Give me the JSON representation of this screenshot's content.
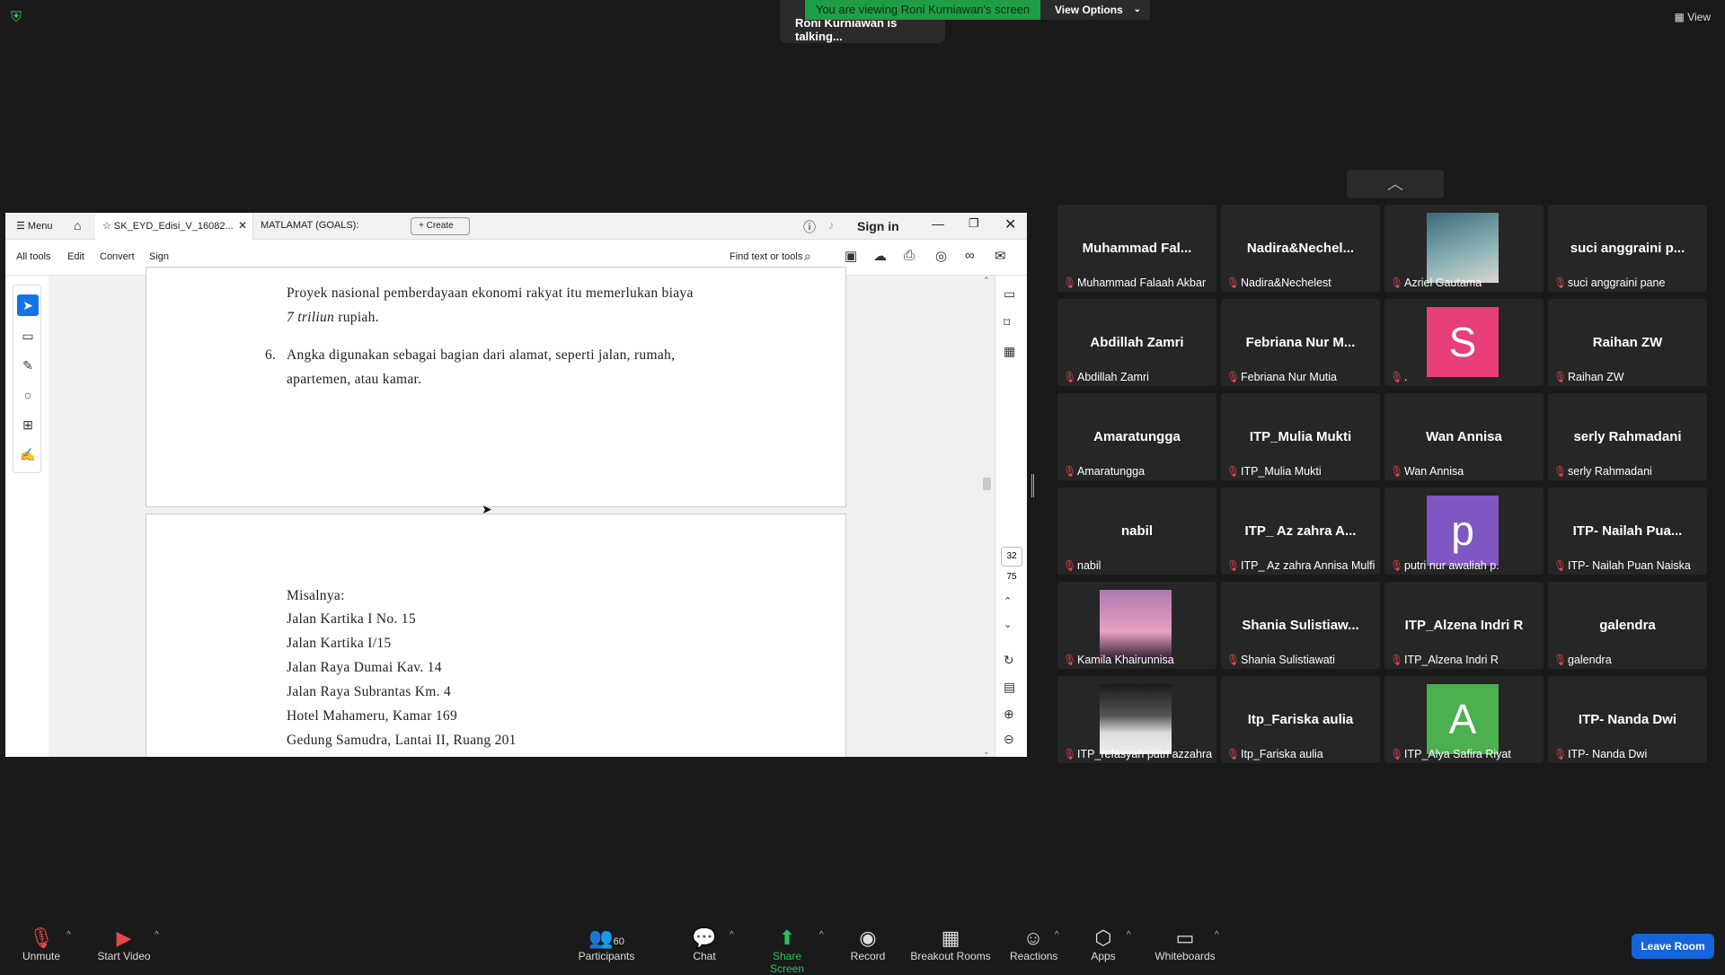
{
  "meeting": {
    "talking": "Roni Kurniawan is talking...",
    "viewing_banner": "You are viewing Roni Kurniawan's screen",
    "view_options": "View Options",
    "view_button": "View"
  },
  "pdf": {
    "menu": "Menu",
    "tab_active": "SK_EYD_Edisi_V_16082...",
    "tab_second": "MATLAMAT (GOALS):",
    "create": "Create",
    "sign_in": "Sign in",
    "toolbar": {
      "all_tools": "All tools",
      "edit": "Edit",
      "convert": "Convert",
      "sign": "Sign",
      "find": "Find text or tools"
    },
    "page1_lines": [
      "Proyek nasional pemberdayaan ekonomi rakyat itu memerlukan biaya",
      "7 triliun rupiah.",
      "Angka digunakan sebagai bagian dari alamat, seperti jalan, rumah,",
      "apartemen, atau kamar."
    ],
    "page1_italic": "7 triliun",
    "page1_after_italic": " rupiah.",
    "item_number": "6.",
    "page2_lines": [
      "Misalnya:",
      "Jalan Kartika I No. 15",
      "Jalan Kartika I/15",
      "Jalan Raya Dumai Kav. 14",
      "Jalan Raya Subrantas Km. 4",
      "Hotel Mahameru, Kamar 169",
      "Gedung Samudra, Lantai II, Ruang 201"
    ],
    "page_number": "32",
    "page_total": "75"
  },
  "participants": [
    {
      "big": "Muhammad Fal...",
      "name": "Muhammad Falaah Akbar"
    },
    {
      "big": "Nadira&Nechel...",
      "name": "Nadira&Nechelest"
    },
    {
      "big": "",
      "name": "Azriel Gautama",
      "photo": "teal"
    },
    {
      "big": "suci anggraini p...",
      "name": "suci anggraini pane"
    },
    {
      "big": "Abdillah Zamri",
      "name": "Abdillah Zamri"
    },
    {
      "big": "Febriana Nur M...",
      "name": "Febriana Nur Mutia"
    },
    {
      "big": "",
      "name": ".",
      "avatar": "S",
      "color": "#e83e7a"
    },
    {
      "big": "Raihan ZW",
      "name": "Raihan ZW"
    },
    {
      "big": "Amaratungga",
      "name": "Amaratungga"
    },
    {
      "big": "ITP_Mulia Mukti",
      "name": "ITP_Mulia Mukti"
    },
    {
      "big": "Wan Annisa",
      "name": "Wan Annisa"
    },
    {
      "big": "serly Rahmadani",
      "name": "serly Rahmadani"
    },
    {
      "big": "nabil",
      "name": "nabil"
    },
    {
      "big": "ITP_ Az zahra A...",
      "name": "ITP_ Az zahra Annisa Mulfi"
    },
    {
      "big": "",
      "name": "putri nur awaliah p.",
      "avatar": "p",
      "color": "#7e57c2"
    },
    {
      "big": "ITP- Nailah Pua...",
      "name": "ITP- Nailah Puan Naiska"
    },
    {
      "big": "",
      "name": "Kamila Khairunnisa",
      "photo": "sunset"
    },
    {
      "big": "Shania  Sulistiaw...",
      "name": "Shania Sulistiawati"
    },
    {
      "big": "ITP_Alzena Indri R",
      "name": "ITP_Alzena Indri R"
    },
    {
      "big": "galendra",
      "name": "galendra"
    },
    {
      "big": "",
      "name": "ITP_refasyah putri azzahra",
      "photo": "bw"
    },
    {
      "big": "Itp_Fariska aulia",
      "name": "Itp_Fariska aulia"
    },
    {
      "big": "",
      "name": "ITP_Alya Safira Riyat",
      "avatar": "A",
      "color": "#4caf50"
    },
    {
      "big": "ITP- Nanda Dwi",
      "name": "ITP- Nanda Dwi"
    }
  ],
  "bottom": {
    "unmute": "Unmute",
    "start_video": "Start Video",
    "participants": "Participants",
    "participants_count": "60",
    "chat": "Chat",
    "share_screen": "Share Screen",
    "record": "Record",
    "breakout": "Breakout Rooms",
    "reactions": "Reactions",
    "apps": "Apps",
    "whiteboards": "Whiteboards",
    "leave": "Leave Room"
  },
  "colors": {
    "share_green": "#22c55e",
    "leave_blue": "#1664d9",
    "muted_red": "#e5484d"
  }
}
